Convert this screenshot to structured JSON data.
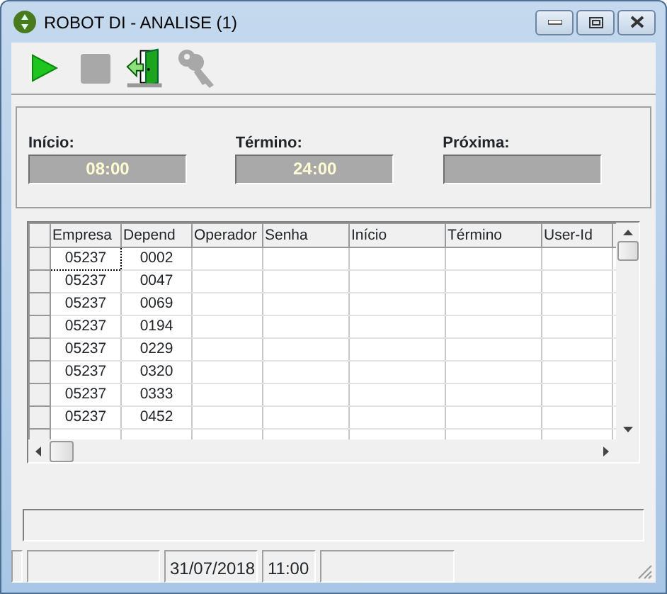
{
  "window": {
    "title": "ROBOT DI - ANALISE (1)"
  },
  "toolbar": [
    {
      "kind": "play",
      "disabled": false
    },
    {
      "kind": "stop",
      "disabled": true
    },
    {
      "kind": "exit",
      "disabled": false
    },
    {
      "kind": "keys",
      "disabled": true
    }
  ],
  "fields": [
    {
      "label": "Início:",
      "value": "08:00"
    },
    {
      "label": "Término:",
      "value": "24:00"
    },
    {
      "label": "Próxima:"
    }
  ],
  "table": {
    "columns": [
      "Empresa",
      "Depend",
      "Operador",
      "Senha",
      "Início",
      "Término",
      "User-Id"
    ],
    "rows": [
      {
        "cells": [
          "05237",
          "0002"
        ],
        "selected": true
      },
      {
        "cells": [
          "05237",
          "0047"
        ],
        "selected": false
      },
      {
        "cells": [
          "05237",
          "0069"
        ],
        "selected": false
      },
      {
        "cells": [
          "05237",
          "0194"
        ],
        "selected": false
      },
      {
        "cells": [
          "05237",
          "0229"
        ],
        "selected": false
      },
      {
        "cells": [
          "05237",
          "0320"
        ],
        "selected": false
      },
      {
        "cells": [
          "05237",
          "0333"
        ],
        "selected": false
      },
      {
        "cells": [
          "05237",
          "0452"
        ],
        "selected": false
      }
    ]
  },
  "status_bar": [
    {
      "kind": "panel"
    },
    {
      "kind": "panel",
      "text": "31/07/2018"
    },
    {
      "kind": "panel",
      "text": "11:00"
    },
    {
      "kind": "panel"
    }
  ]
}
